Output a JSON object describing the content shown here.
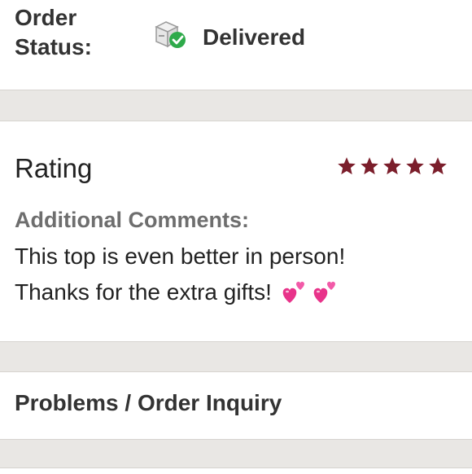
{
  "order_status": {
    "label_line1": "Order",
    "label_line2": "Status:",
    "icon": "box-check-icon",
    "value": "Delivered"
  },
  "rating": {
    "title": "Rating",
    "stars": 5,
    "max_stars": 5,
    "star_color": "#7b1e2b"
  },
  "comments": {
    "heading": "Additional Comments:",
    "line1": "This top is even better in person!",
    "line2": "Thanks for the extra gifts!",
    "emoji": "two-hearts-icon"
  },
  "problems": {
    "title": "Problems / Order Inquiry"
  },
  "colors": {
    "background": "#e9e7e4",
    "card": "#ffffff",
    "success_green": "#2eaa4a",
    "heart_pink": "#e8338a"
  }
}
